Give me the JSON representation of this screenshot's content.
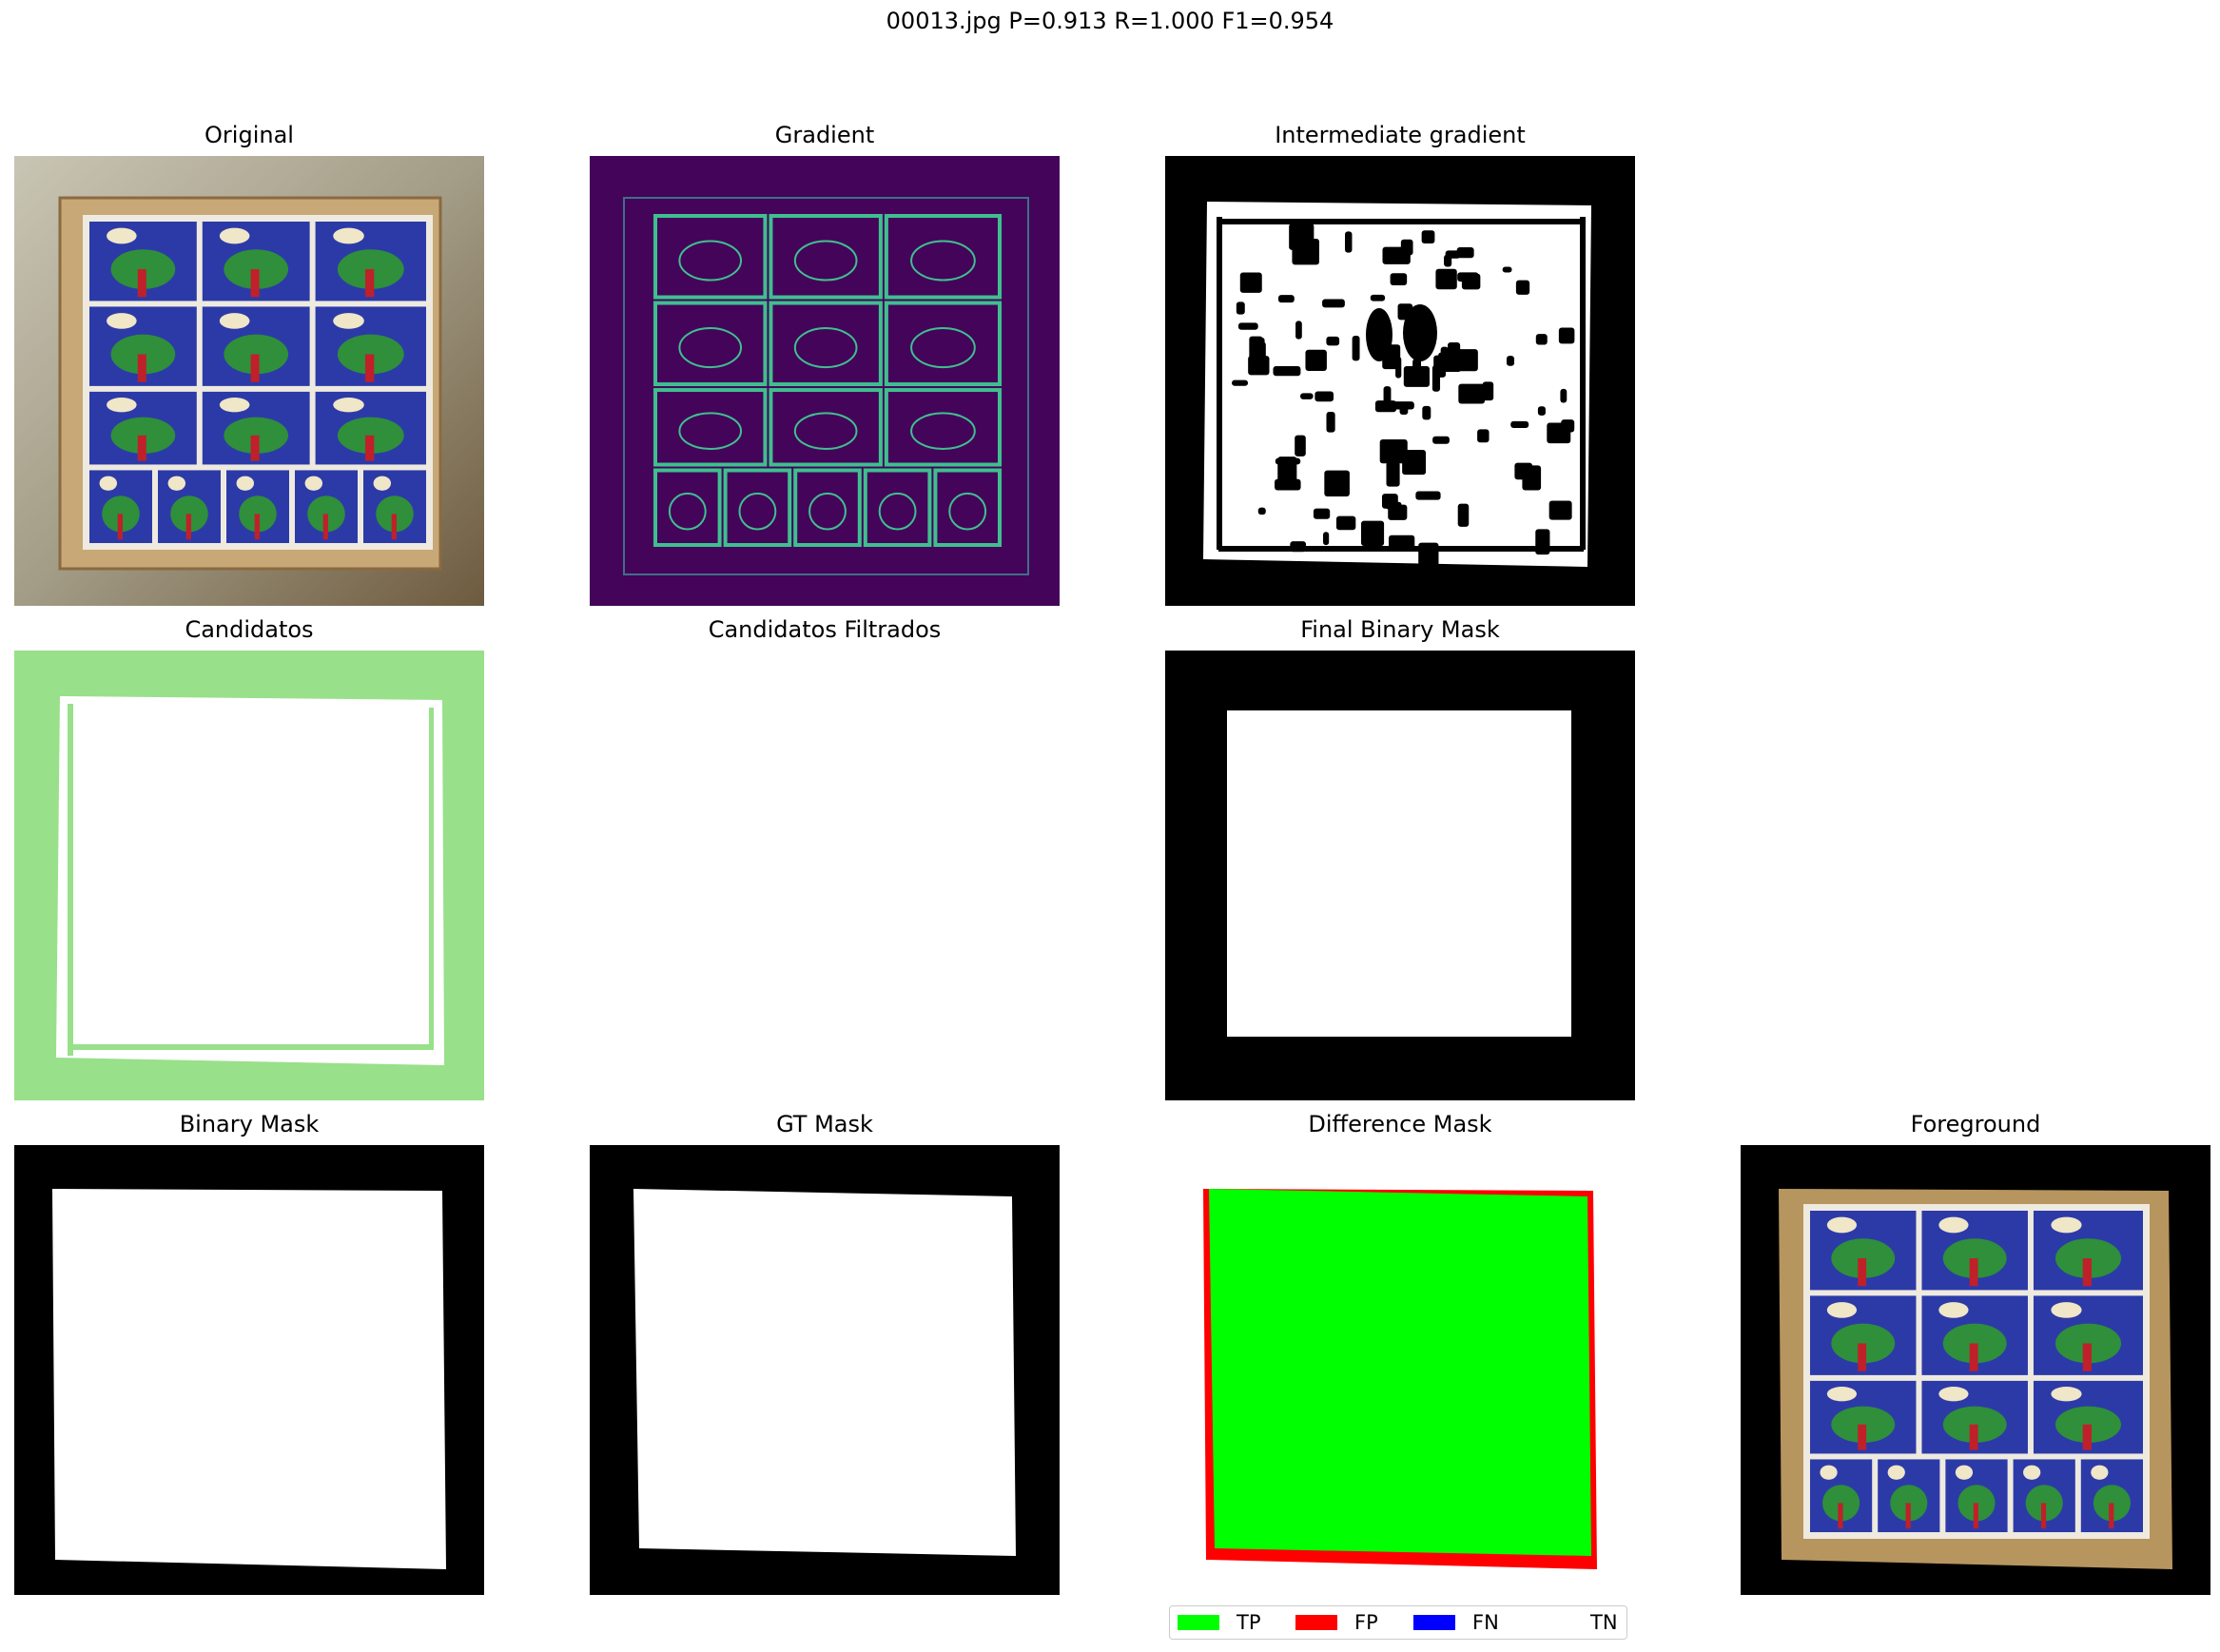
{
  "figure": {
    "suptitle": "00013.jpg  P=0.913 R=1.000 F1=0.954"
  },
  "panels": {
    "original": "Original",
    "gradient": "Gradient",
    "intermediate": "Intermediate gradient",
    "candidatos": "Candidatos",
    "filtrados": "Candidatos Filtrados",
    "final_mask": "Final Binary Mask",
    "binary_mask": "Binary Mask",
    "gt_mask": "GT Mask",
    "difference": "Difference Mask",
    "foreground": "Foreground"
  },
  "legend": [
    {
      "label": "TP",
      "color": "#00ff00"
    },
    {
      "label": "FP",
      "color": "#ff0000"
    },
    {
      "label": "FN",
      "color": "#0000ff"
    },
    {
      "label": "TN",
      "color": ""
    }
  ],
  "colors": {
    "gradient_bg": "#44045a",
    "gradient_line": "#3fbf8f",
    "candidate_green": "#98e08a",
    "mask_black": "#000000",
    "mask_white": "#ffffff"
  }
}
